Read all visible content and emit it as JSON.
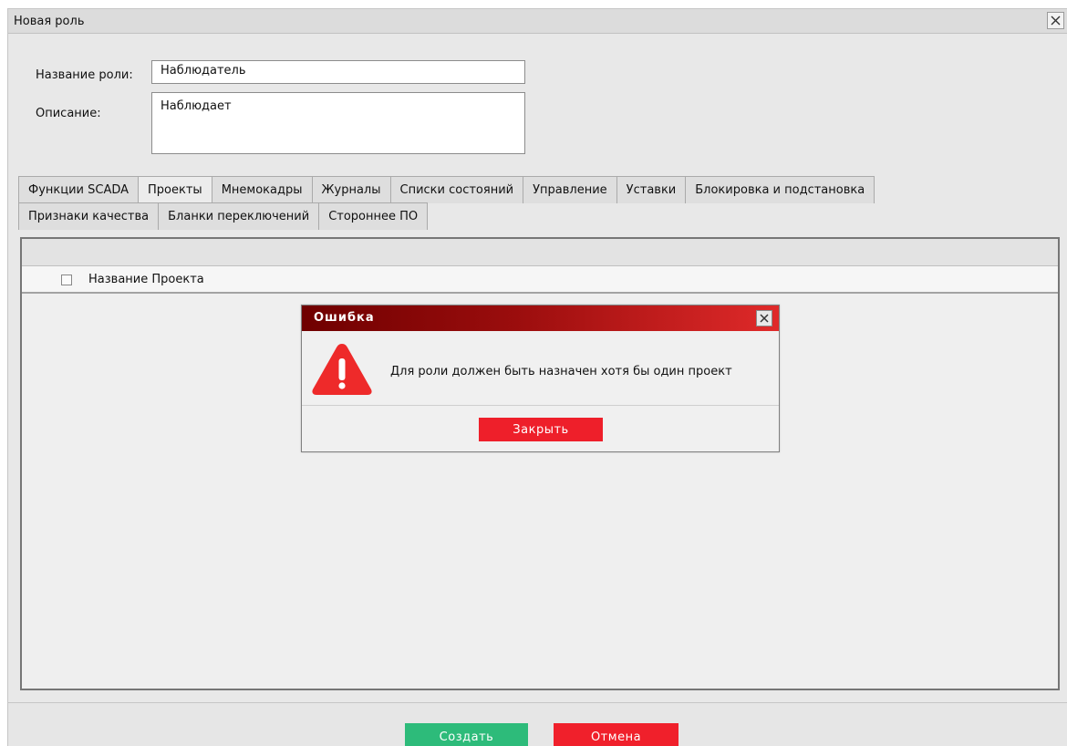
{
  "window": {
    "title": "Новая роль",
    "close_icon": "close-icon"
  },
  "form": {
    "name_label": "Название роли:",
    "name_value": "Наблюдатель",
    "description_label": "Описание:",
    "description_value": "Наблюдает"
  },
  "tabs": {
    "row1": [
      "Функции SCADA",
      "Проекты",
      "Мнемокадры",
      "Журналы",
      "Списки состояний",
      "Управление",
      "Уставки",
      "Блокировка и подстановка"
    ],
    "row2": [
      "Признаки качества",
      "Бланки переключений",
      "Стороннее ПО"
    ],
    "active": "Проекты"
  },
  "projects_table": {
    "column_label": "Название Проекта",
    "select_all_checked": false
  },
  "footer": {
    "create_label": "Создать",
    "cancel_label": "Отмена"
  },
  "error_dialog": {
    "title": "Ошибка",
    "message": "Для роли должен быть назначен хотя бы один проект",
    "close_label": "Закрыть",
    "icon": "warning-icon"
  },
  "colors": {
    "create_button": "#2dbb7a",
    "cancel_button": "#f0202b",
    "dialog_title_start": "#6f0000",
    "dialog_title_end": "#e02a2a",
    "warning_icon": "#ee2a2a"
  }
}
